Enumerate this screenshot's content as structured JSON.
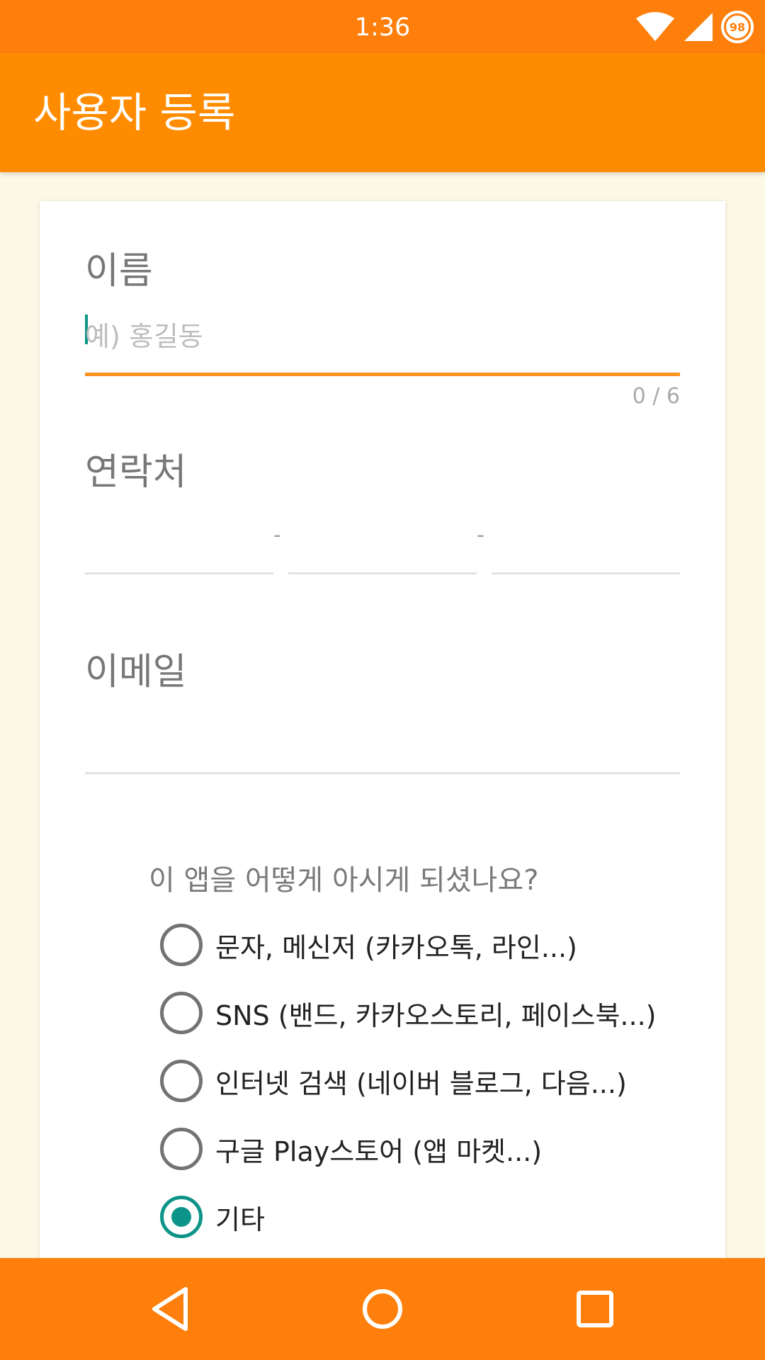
{
  "status_bar": {
    "time": "1:36",
    "battery_level": "98",
    "icons": [
      "wifi-icon",
      "cell-signal-icon",
      "battery-icon"
    ]
  },
  "app_bar": {
    "title": "사용자 등록"
  },
  "form": {
    "name": {
      "label": "이름",
      "placeholder": "예) 홍길동",
      "value": "",
      "counter": "0 / 6"
    },
    "contact": {
      "label": "연락처",
      "separator": "-",
      "parts": [
        "",
        "",
        ""
      ]
    },
    "email": {
      "label": "이메일",
      "value": ""
    },
    "referral": {
      "question": "이 앱을 어떻게 아시게 되셨나요?",
      "options": [
        {
          "label": "문자, 메신저 (카카오톡, 라인...)",
          "checked": false
        },
        {
          "label": "SNS (밴드, 카카오스토리, 페이스북...)",
          "checked": false
        },
        {
          "label": "인터넷 검색 (네이버 블로그, 다음...)",
          "checked": false
        },
        {
          "label": "구글 Play스토어 (앱 마켓...)",
          "checked": false
        },
        {
          "label": "기타",
          "checked": true
        }
      ]
    }
  },
  "nav_bar": {
    "icons": [
      "back-icon",
      "home-icon",
      "recents-icon"
    ]
  },
  "colors": {
    "status_bar": "#fe7f0b",
    "app_bar": "#ff8c00",
    "accent": "#0d9488",
    "field_active": "#f7931e",
    "background": "#fdf8e6"
  }
}
